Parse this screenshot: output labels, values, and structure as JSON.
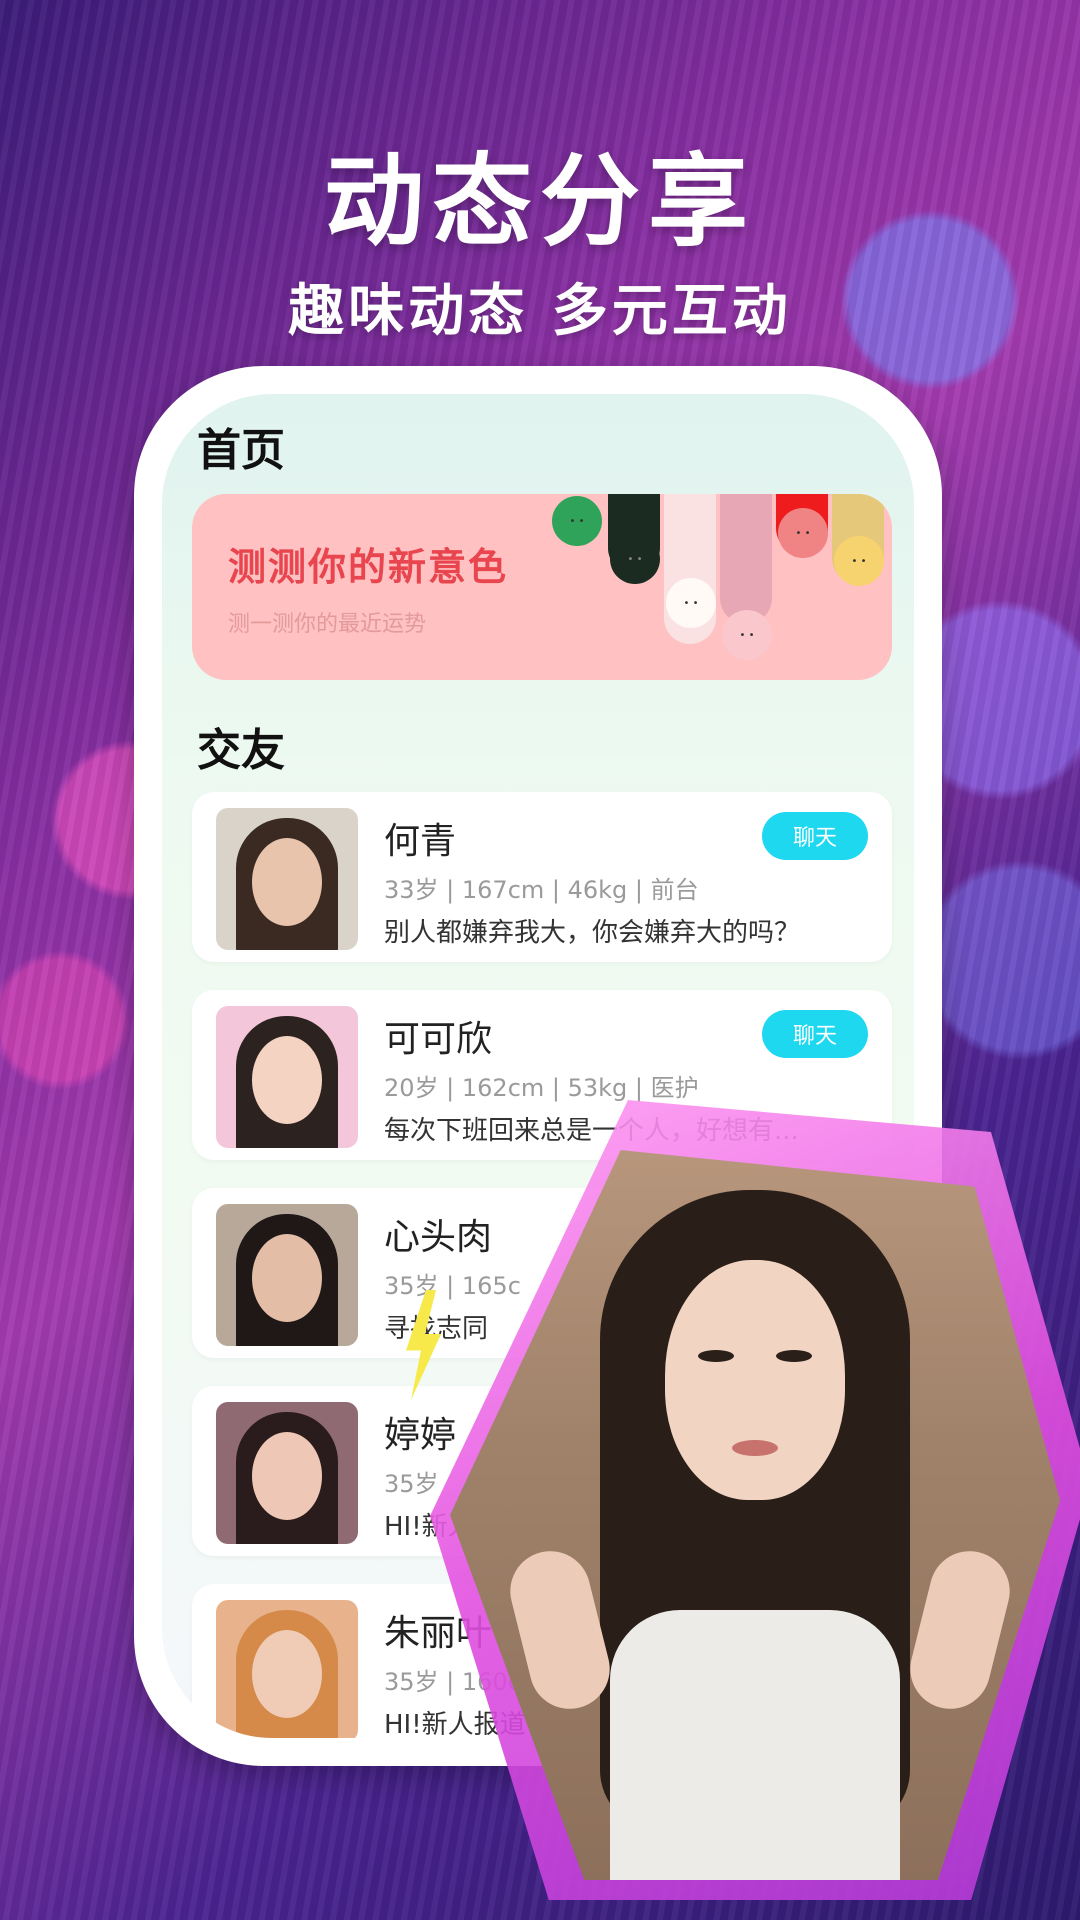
{
  "hero": {
    "title": "动态分享",
    "subtitle": "趣味动态  多元互动"
  },
  "home": {
    "section_title": "首页",
    "banner": {
      "title": "测测你的新意色",
      "subtitle": "测一测你的最近运势"
    }
  },
  "friends": {
    "section_title": "交友",
    "chat_label": "聊天",
    "items": [
      {
        "name": "何青",
        "meta": "33岁 | 167cm | 46kg | 前台",
        "bio": "别人都嫌弃我大，你会嫌弃大的吗？"
      },
      {
        "name": "可可欣",
        "meta": "20岁 | 162cm | 53kg | 医护",
        "bio": "每次下班回来总是一个人，好想有..."
      },
      {
        "name": "心头肉",
        "meta": "35岁 | 165c",
        "bio": "寻找志同"
      },
      {
        "name": "婷婷",
        "meta": "35岁",
        "bio": "HI!新人"
      },
      {
        "name": "朱丽叶",
        "meta": "35岁 | 160c",
        "bio": "HI!新人报道  请"
      }
    ]
  },
  "colors": {
    "chat_button": "#1ed8f0",
    "banner_bg": "#ffc1c1",
    "banner_title": "#e8454e"
  }
}
